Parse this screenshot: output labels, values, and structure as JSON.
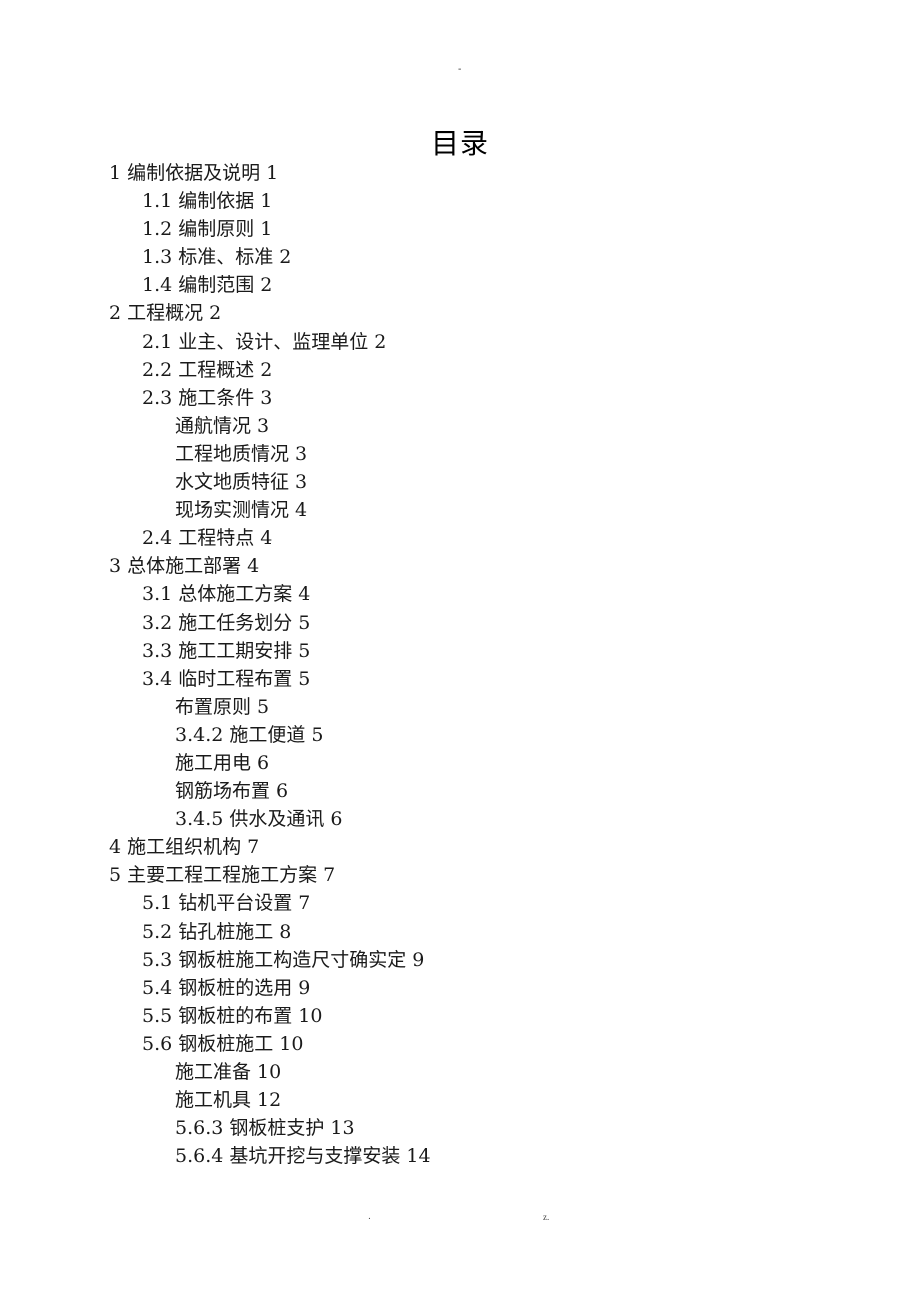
{
  "header": {
    "mark": "-"
  },
  "title": "目录",
  "toc": [
    {
      "level": 1,
      "text": "1 编制依据及说明 1"
    },
    {
      "level": 2,
      "text": "1.1 编制依据 1"
    },
    {
      "level": 2,
      "text": "1.2 编制原则 1"
    },
    {
      "level": 2,
      "text": "1.3 标准、标准 2"
    },
    {
      "level": 2,
      "text": "1.4 编制范围 2"
    },
    {
      "level": 1,
      "text": "2 工程概况 2"
    },
    {
      "level": 2,
      "text": "2.1 业主、设计、监理单位 2"
    },
    {
      "level": 2,
      "text": "2.2 工程概述 2"
    },
    {
      "level": 2,
      "text": "2.3 施工条件 3"
    },
    {
      "level": 3,
      "text": "通航情况 3"
    },
    {
      "level": 3,
      "text": "工程地质情况 3"
    },
    {
      "level": 3,
      "text": "水文地质特征 3"
    },
    {
      "level": 3,
      "text": "现场实测情况 4"
    },
    {
      "level": 2,
      "text": "2.4 工程特点 4"
    },
    {
      "level": 1,
      "text": "3 总体施工部署 4"
    },
    {
      "level": 2,
      "text": "3.1 总体施工方案 4"
    },
    {
      "level": 2,
      "text": "3.2 施工任务划分 5"
    },
    {
      "level": 2,
      "text": "3.3 施工工期安排 5"
    },
    {
      "level": 2,
      "text": "3.4 临时工程布置 5"
    },
    {
      "level": 3,
      "text": "布置原则 5"
    },
    {
      "level": 3,
      "text": "3.4.2  施工便道 5"
    },
    {
      "level": 3,
      "text": "施工用电 6"
    },
    {
      "level": 3,
      "text": "钢筋场布置 6"
    },
    {
      "level": 3,
      "text": "3.4.5  供水及通讯 6"
    },
    {
      "level": 1,
      "text": "4 施工组织机构 7"
    },
    {
      "level": 1,
      "text": "5 主要工程工程施工方案 7"
    },
    {
      "level": 2,
      "text": "5.1 钻机平台设置 7"
    },
    {
      "level": 2,
      "text": "5.2 钻孔桩施工 8"
    },
    {
      "level": 2,
      "text": "5.3 钢板桩施工构造尺寸确实定 9"
    },
    {
      "level": 2,
      "text": "5.4 钢板桩的选用 9"
    },
    {
      "level": 2,
      "text": "5.5 钢板桩的布置 10"
    },
    {
      "level": 2,
      "text": "5.6 钢板桩施工 10"
    },
    {
      "level": 3,
      "text": "施工准备 10"
    },
    {
      "level": 3,
      "text": "施工机具 12"
    },
    {
      "level": 3,
      "text": "5.6.3  钢板桩支护 13"
    },
    {
      "level": 3,
      "text": "5.6.4  基坑开挖与支撑安装 14"
    }
  ],
  "footer": {
    "left": ".",
    "right": "z."
  }
}
